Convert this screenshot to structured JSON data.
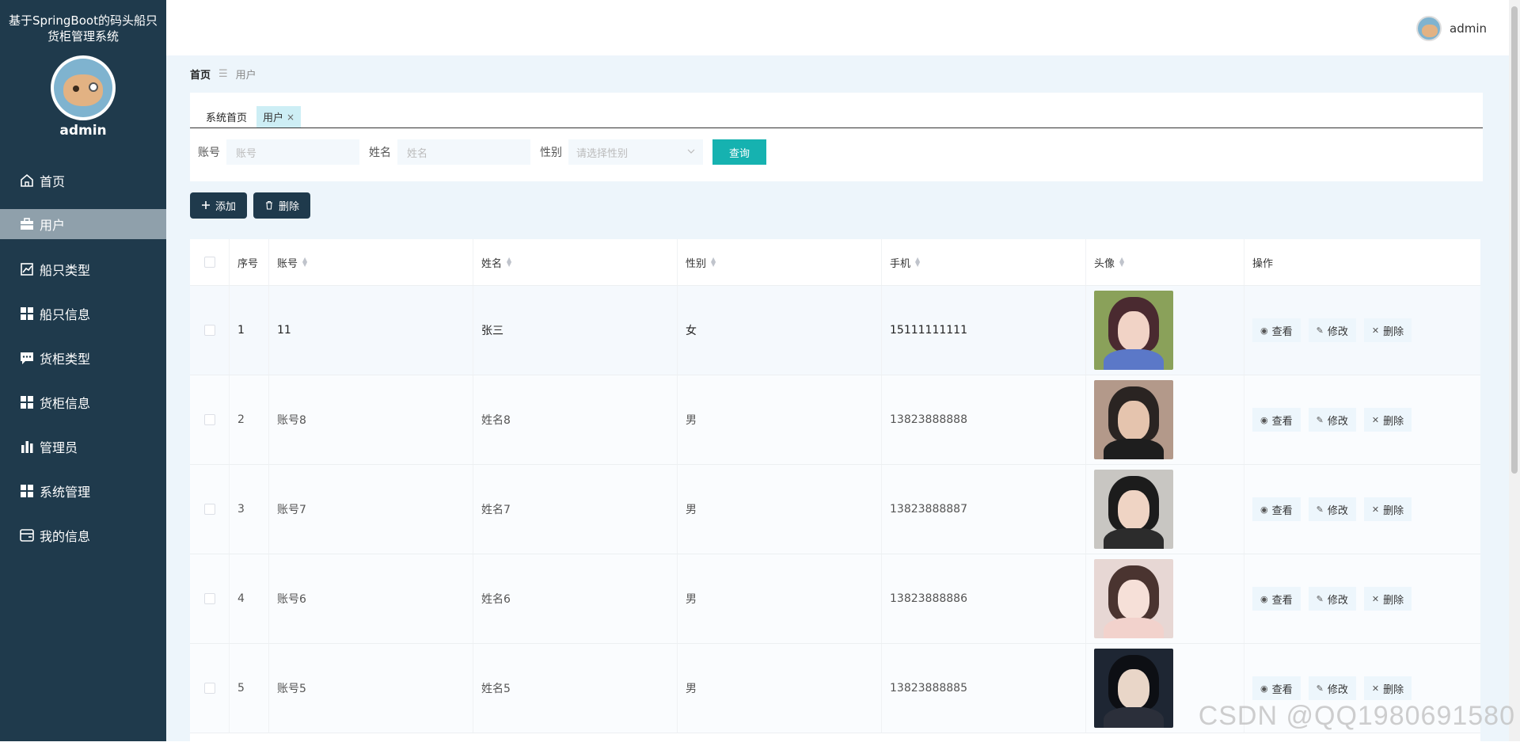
{
  "app": {
    "title": "基于SpringBoot的码头船只货柜管理系统",
    "user": "admin"
  },
  "sidebar": {
    "items": [
      {
        "label": "首页",
        "icon": "home-icon"
      },
      {
        "label": "用户",
        "icon": "briefcase-icon",
        "active": true
      },
      {
        "label": "船只类型",
        "icon": "chart-icon"
      },
      {
        "label": "船只信息",
        "icon": "grid-icon"
      },
      {
        "label": "货柜类型",
        "icon": "chat-icon"
      },
      {
        "label": "货柜信息",
        "icon": "grid-icon"
      },
      {
        "label": "管理员",
        "icon": "bar-chart-icon"
      },
      {
        "label": "系统管理",
        "icon": "grid-icon"
      },
      {
        "label": "我的信息",
        "icon": "card-icon"
      }
    ]
  },
  "header": {
    "user": "admin"
  },
  "breadcrumb": {
    "home": "首页",
    "separator": "☰",
    "current": "用户"
  },
  "tabs": [
    {
      "label": "系统首页"
    },
    {
      "label": "用户",
      "close": "×"
    }
  ],
  "search": {
    "account_label": "账号",
    "account_placeholder": "账号",
    "name_label": "姓名",
    "name_placeholder": "姓名",
    "gender_label": "性别",
    "gender_placeholder": "请选择性别",
    "query_button": "查询"
  },
  "toolbar": {
    "add": "添加",
    "delete": "删除"
  },
  "table": {
    "columns": {
      "index": "序号",
      "account": "账号",
      "name": "姓名",
      "gender": "性别",
      "phone": "手机",
      "avatar": "头像",
      "operation": "操作"
    },
    "row_actions": {
      "view": "查看",
      "edit": "修改",
      "delete": "删除"
    },
    "rows": [
      {
        "index": "1",
        "account": "11",
        "name": "张三",
        "gender": "女",
        "phone": "15111111111"
      },
      {
        "index": "2",
        "account": "账号8",
        "name": "姓名8",
        "gender": "男",
        "phone": "13823888888"
      },
      {
        "index": "3",
        "account": "账号7",
        "name": "姓名7",
        "gender": "男",
        "phone": "13823888887"
      },
      {
        "index": "4",
        "account": "账号6",
        "name": "姓名6",
        "gender": "男",
        "phone": "13823888886"
      },
      {
        "index": "5",
        "account": "账号5",
        "name": "姓名5",
        "gender": "男",
        "phone": "13823888885"
      }
    ]
  },
  "watermark": "CSDN @QQ1980691580",
  "colors": {
    "sidebar": "#1f3a4c",
    "accent": "#16b2b0",
    "main_bg": "#edf5fb"
  }
}
